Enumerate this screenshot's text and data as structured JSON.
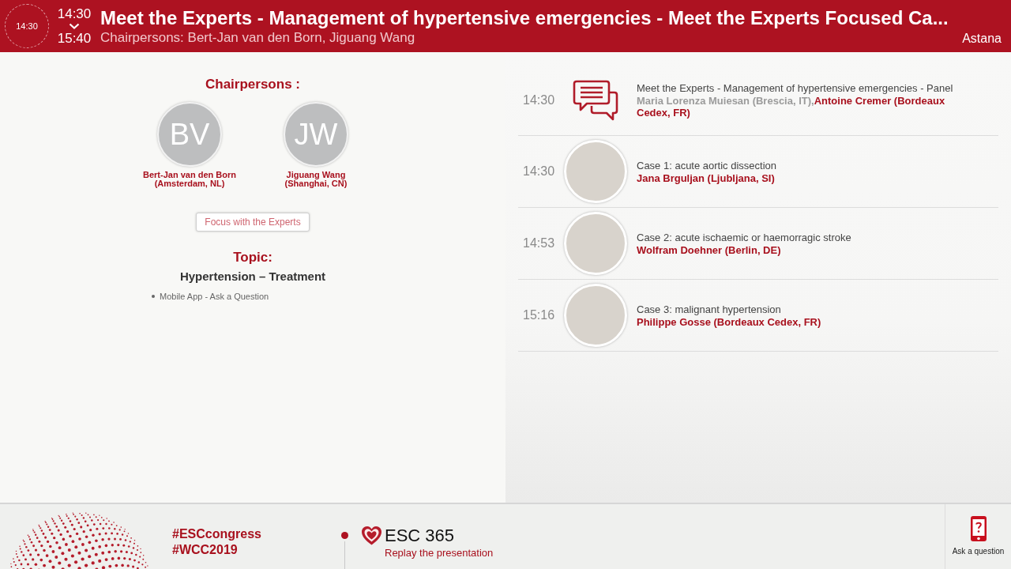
{
  "header": {
    "current_time": "14:30",
    "start_time": "14:30",
    "end_time": "15:40",
    "title": "Meet the Experts - Management of hypertensive emergencies - Meet the Experts Focused Ca...",
    "subtitle": "Chairpersons: Bert-Jan van den Born, Jiguang Wang",
    "room": "Astana"
  },
  "chairpersons": {
    "heading": "Chairpersons :",
    "people": [
      {
        "initials": "BV",
        "name": "Bert-Jan van den Born",
        "affiliation": "(Amsterdam, NL)"
      },
      {
        "initials": "JW",
        "name": "Jiguang Wang",
        "affiliation": "(Shanghai, CN)"
      }
    ]
  },
  "focus_button": "Focus with the Experts",
  "topic": {
    "heading": "Topic:",
    "title": "Hypertension – Treatment",
    "items": [
      "Mobile App - Ask a Question"
    ]
  },
  "schedule": [
    {
      "time": "14:30",
      "kind": "panel",
      "title": "Meet the Experts - Management of hypertensive emergencies - Panel",
      "speakers": [
        {
          "name": "Maria Lorenza Muiesan (Brescia, IT),",
          "dimmed": true
        },
        {
          "name": "Antoine Cremer (Bordeaux Cedex, FR)",
          "dimmed": false
        }
      ]
    },
    {
      "time": "14:30",
      "kind": "talk",
      "title": "Case 1: acute aortic dissection",
      "speakers": [
        {
          "name": "Jana Brguljan (Ljubljana, SI)",
          "dimmed": false
        }
      ]
    },
    {
      "time": "14:53",
      "kind": "talk",
      "title": "Case 2: acute ischaemic or haemorragic stroke",
      "speakers": [
        {
          "name": "Wolfram Doehner (Berlin, DE)",
          "dimmed": false
        }
      ]
    },
    {
      "time": "15:16",
      "kind": "talk",
      "title": "Case 3: malignant hypertension",
      "speakers": [
        {
          "name": "Philippe Gosse (Bordeaux Cedex, FR)",
          "dimmed": false
        }
      ]
    }
  ],
  "footer": {
    "hashtags": [
      "#ESCcongress",
      "#WCC2019"
    ],
    "replay": {
      "logo": "ESC 365",
      "caption": "Replay the presentation"
    },
    "ask_button": "Ask a question"
  }
}
